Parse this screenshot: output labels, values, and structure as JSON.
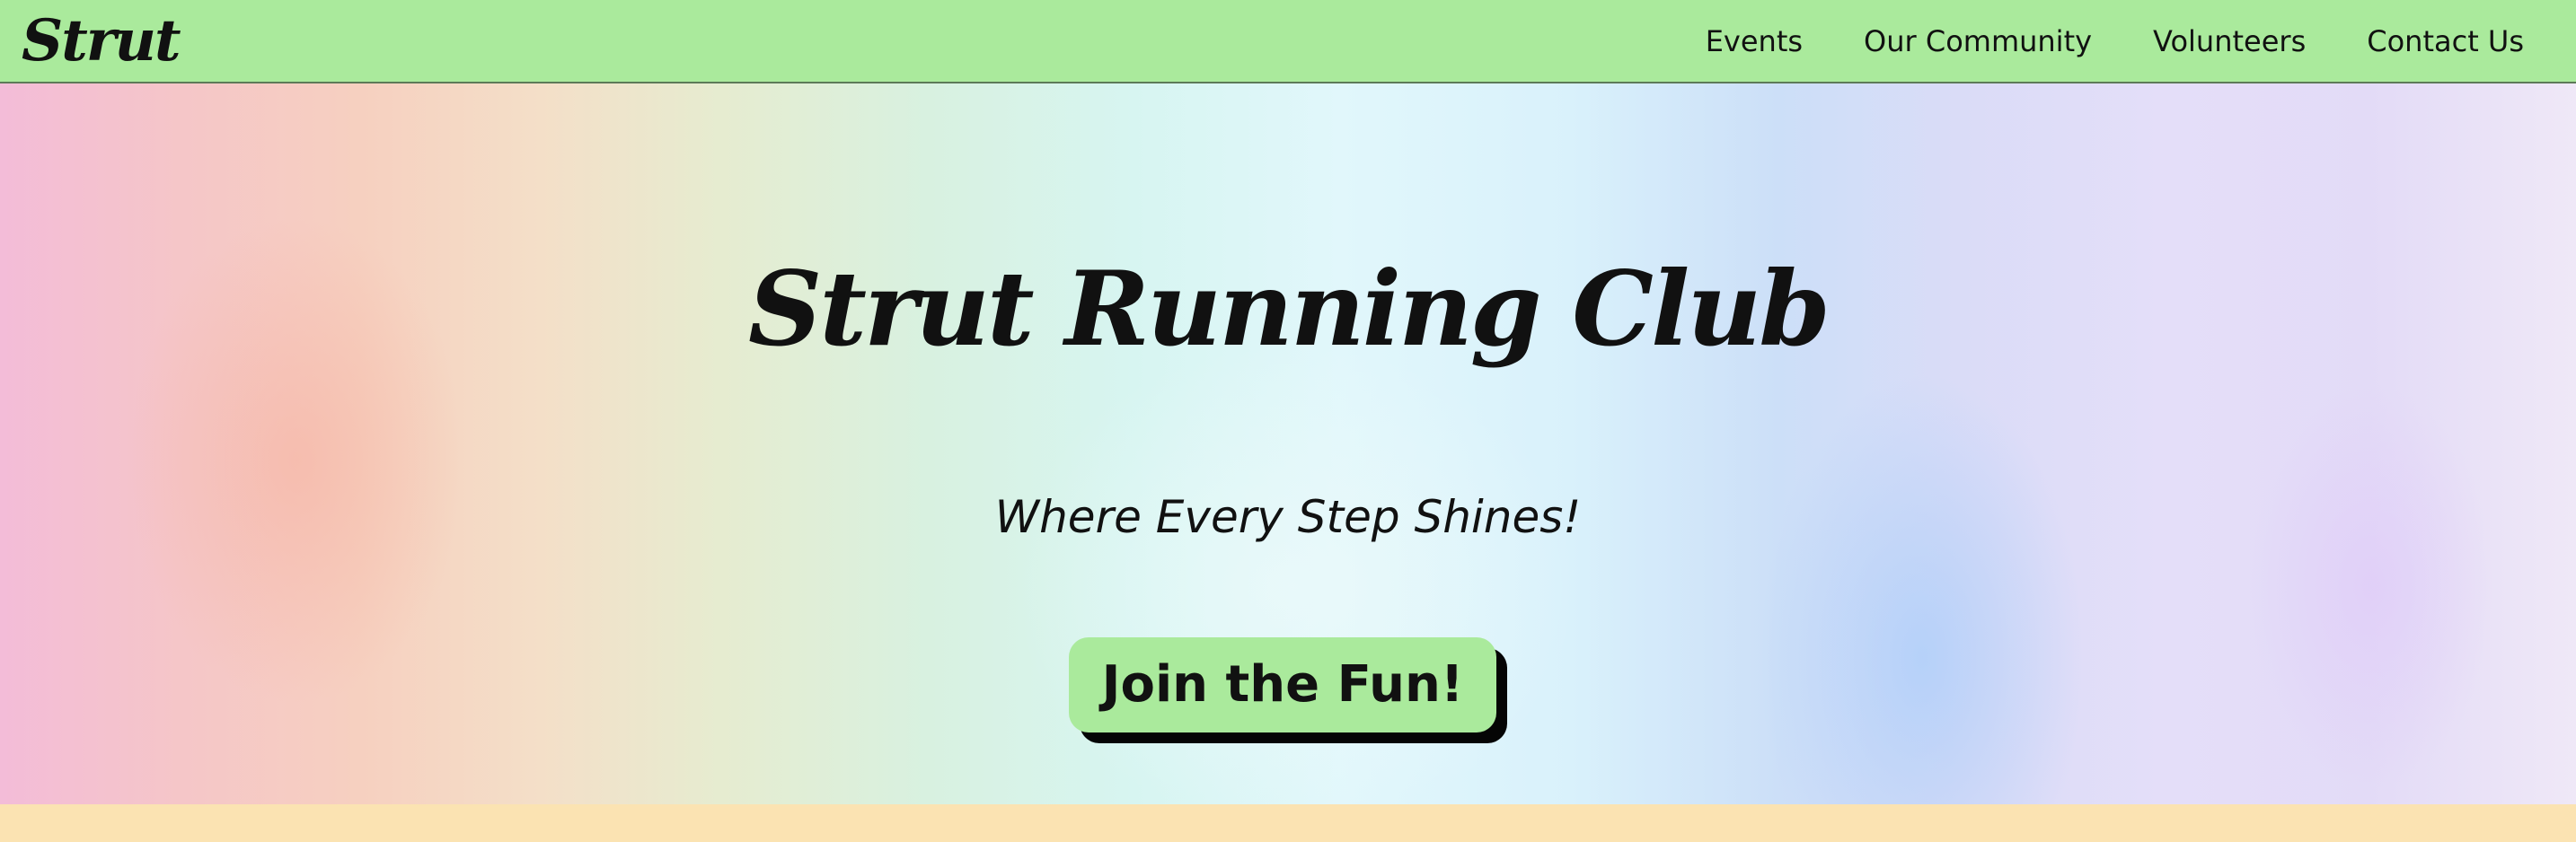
{
  "header": {
    "logo_text": "Strut",
    "nav": [
      {
        "label": "Events"
      },
      {
        "label": "Our Community"
      },
      {
        "label": "Volunteers"
      },
      {
        "label": "Contact Us"
      }
    ]
  },
  "hero": {
    "title": "Strut Running Club",
    "subtitle": "Where Every Step Shines!",
    "cta_label": "Join the Fun!"
  },
  "colors": {
    "nav_background": "#aaea9c",
    "button_background": "#aaea9c",
    "button_shadow": "#050505",
    "text": "#111111",
    "footer_band": "#fbe3b2"
  }
}
